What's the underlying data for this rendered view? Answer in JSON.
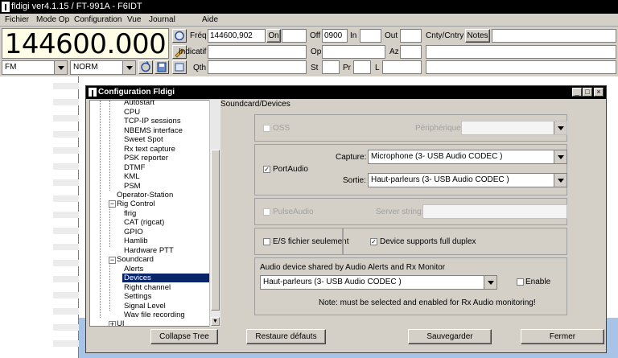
{
  "window": {
    "title": "fldigi ver4.1.15 / FT-991A - F6IDT"
  },
  "menubar": [
    {
      "label": "Fichier"
    },
    {
      "label": "Mode Op"
    },
    {
      "label": "Configuration"
    },
    {
      "label": "Vue"
    },
    {
      "label": "Journal"
    },
    {
      "label": "Aide"
    }
  ],
  "frequency_display": "144600.000",
  "log": {
    "freq_label": "Fréq",
    "freq_value": "144600,902",
    "on_label": "On",
    "off_label": "Off",
    "off_value": "0900",
    "in_label": "In",
    "out_label": "Out",
    "cnty_label": "Cnty/Cntry",
    "notes_label": "Notes",
    "call_label": "Indicatif",
    "op_label": "Op",
    "az_label": "Az",
    "qth_label": "Qth",
    "st_label": "St",
    "pr_label": "Pr",
    "l_label": "L"
  },
  "mode_select": "FM",
  "bw_select": "NORM",
  "dialog": {
    "title": "Configuration Fldigi",
    "section_title": "Soundcard/Devices",
    "tree": [
      {
        "label": "Autostart"
      },
      {
        "label": "CPU"
      },
      {
        "label": "TCP-IP sessions"
      },
      {
        "label": "NBEMS interface"
      },
      {
        "label": "Sweet Spot"
      },
      {
        "label": "Rx text capture"
      },
      {
        "label": "PSK reporter"
      },
      {
        "label": "DTMF"
      },
      {
        "label": "KML"
      },
      {
        "label": "PSM"
      },
      {
        "label": "Operator-Station"
      },
      {
        "label": "Rig Control"
      },
      {
        "label": "flrig"
      },
      {
        "label": "CAT (rigcat)"
      },
      {
        "label": "GPIO"
      },
      {
        "label": "Hamlib"
      },
      {
        "label": "Hardware PTT"
      },
      {
        "label": "Soundcard"
      },
      {
        "label": "Alerts"
      },
      {
        "label": "Devices"
      },
      {
        "label": "Right channel"
      },
      {
        "label": "Settings"
      },
      {
        "label": "Signal Level"
      },
      {
        "label": "Wav file recording"
      },
      {
        "label": "UI"
      }
    ],
    "oss": {
      "label": "OSS",
      "device_label": "Périphérique:",
      "device_value": ""
    },
    "portaudio": {
      "label": "PortAudio",
      "capture_label": "Capture:",
      "capture_value": "Microphone (3- USB Audio CODEC )",
      "playback_label": "Sortie:",
      "playback_value": "Haut-parleurs (3- USB Audio CODEC )"
    },
    "pulseaudio": {
      "label": "PulseAudio",
      "server_label": "Server string:",
      "server_value": ""
    },
    "file_io_label": "E/S fichier seulement",
    "full_duplex_label": "Device supports full duplex",
    "alerts_group_label": "Audio device shared by Audio Alerts and Rx Monitor",
    "alerts_device_value": "Haut-parleurs (3- USB Audio CODEC )",
    "enable_label": "Enable",
    "note": "Note: must be selected and enabled for Rx Audio monitoring!",
    "collapse_label": "Collapse Tree",
    "restore_label": "Restaure défauts",
    "save_label": "Sauvegarder",
    "close_label": "Fermer"
  },
  "colors": {
    "freq_bg": "#fffde6",
    "selection": "#0a246a",
    "desktop_blue": "#a7c4e6"
  }
}
